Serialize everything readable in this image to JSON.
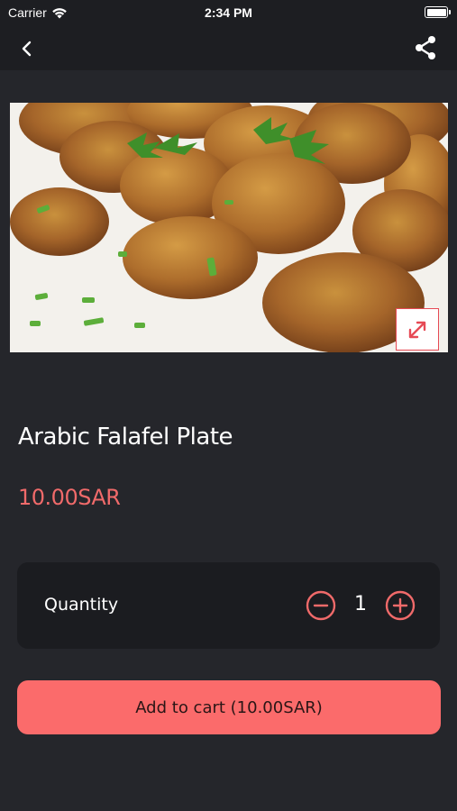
{
  "status_bar": {
    "carrier": "Carrier",
    "time": "2:34 PM"
  },
  "nav": {
    "back_icon": "chevron-left-icon",
    "share_icon": "share-icon"
  },
  "product": {
    "image_description_icon": "product-photo",
    "title": "Arabic Falafel Plate",
    "price": "10.00SAR"
  },
  "quantity": {
    "label": "Quantity",
    "value": "1",
    "minus_icon": "minus-circle-icon",
    "plus_icon": "plus-circle-icon"
  },
  "cart_button": {
    "label": "Add to cart (10.00SAR)"
  },
  "colors": {
    "background": "#25262b",
    "accent": "#fb6b6b",
    "price": "#f06a6a",
    "card": "#1b1c20"
  }
}
